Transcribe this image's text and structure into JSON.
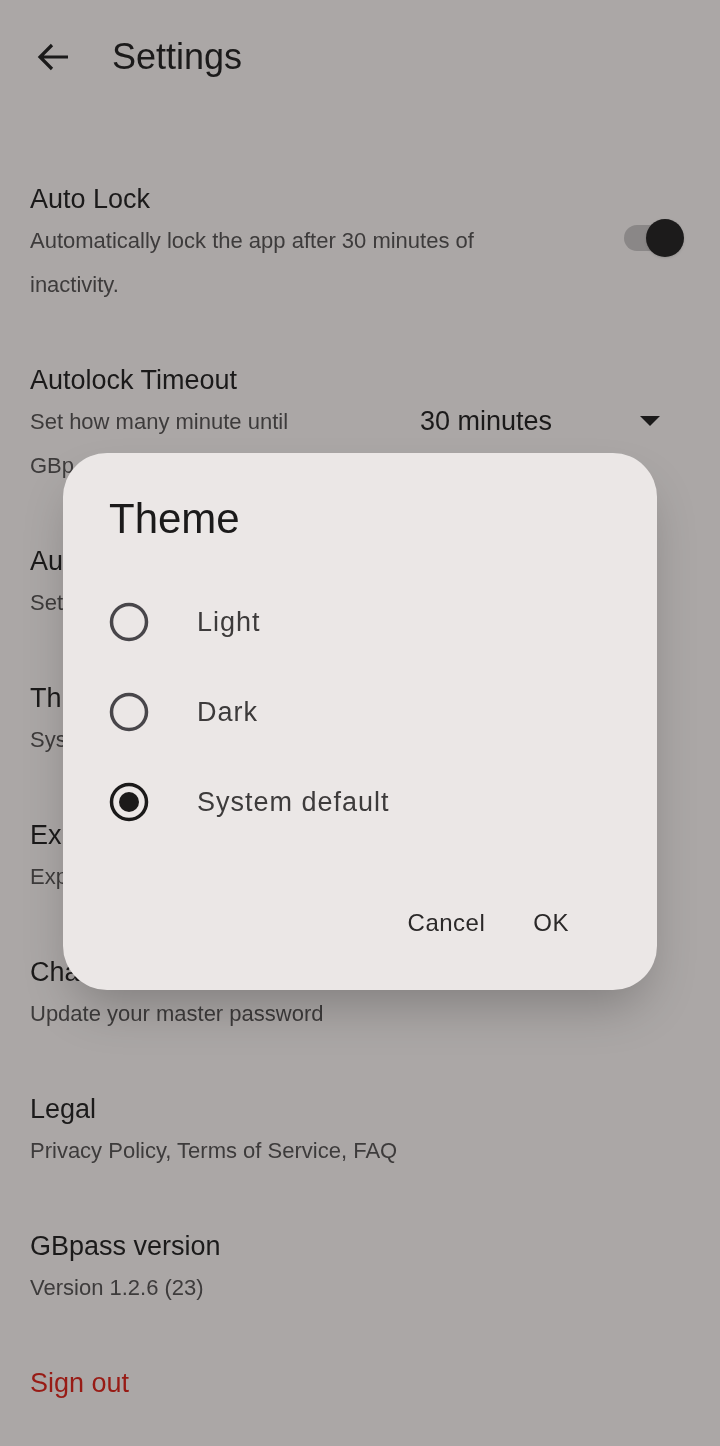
{
  "app_bar": {
    "title": "Settings"
  },
  "settings": [
    {
      "kind": "switch",
      "title": "Auto Lock",
      "subtitle": [
        "Automatically lock the app after 30 minutes of",
        "inactivity."
      ],
      "on": true
    },
    {
      "kind": "dropdown",
      "title": "Autolock Timeout",
      "subtitle": [
        "Set how many minute until",
        "GBp"
      ],
      "value": "30 minutes"
    },
    {
      "kind": "plain",
      "title": "Au",
      "subtitle": [
        "Set"
      ]
    },
    {
      "kind": "plain",
      "title": "Th",
      "subtitle": [
        "Sys"
      ]
    },
    {
      "kind": "plain",
      "title": "Ex",
      "subtitle": [
        "Exp"
      ]
    },
    {
      "kind": "plain",
      "title": "Cha",
      "subtitle": [
        "Update your master password"
      ]
    },
    {
      "kind": "plain",
      "title": "Legal",
      "subtitle": [
        "Privacy Policy, Terms of Service, FAQ"
      ]
    },
    {
      "kind": "plain",
      "title": "GBpass version",
      "subtitle": [
        "Version 1.2.6 (23)"
      ]
    }
  ],
  "sign_out": {
    "label": "Sign out"
  },
  "dialog": {
    "title": "Theme",
    "options": [
      {
        "label": "Light",
        "selected": false
      },
      {
        "label": "Dark",
        "selected": false
      },
      {
        "label": "System default",
        "selected": true
      }
    ],
    "buttons": [
      "Cancel",
      "OK"
    ]
  }
}
